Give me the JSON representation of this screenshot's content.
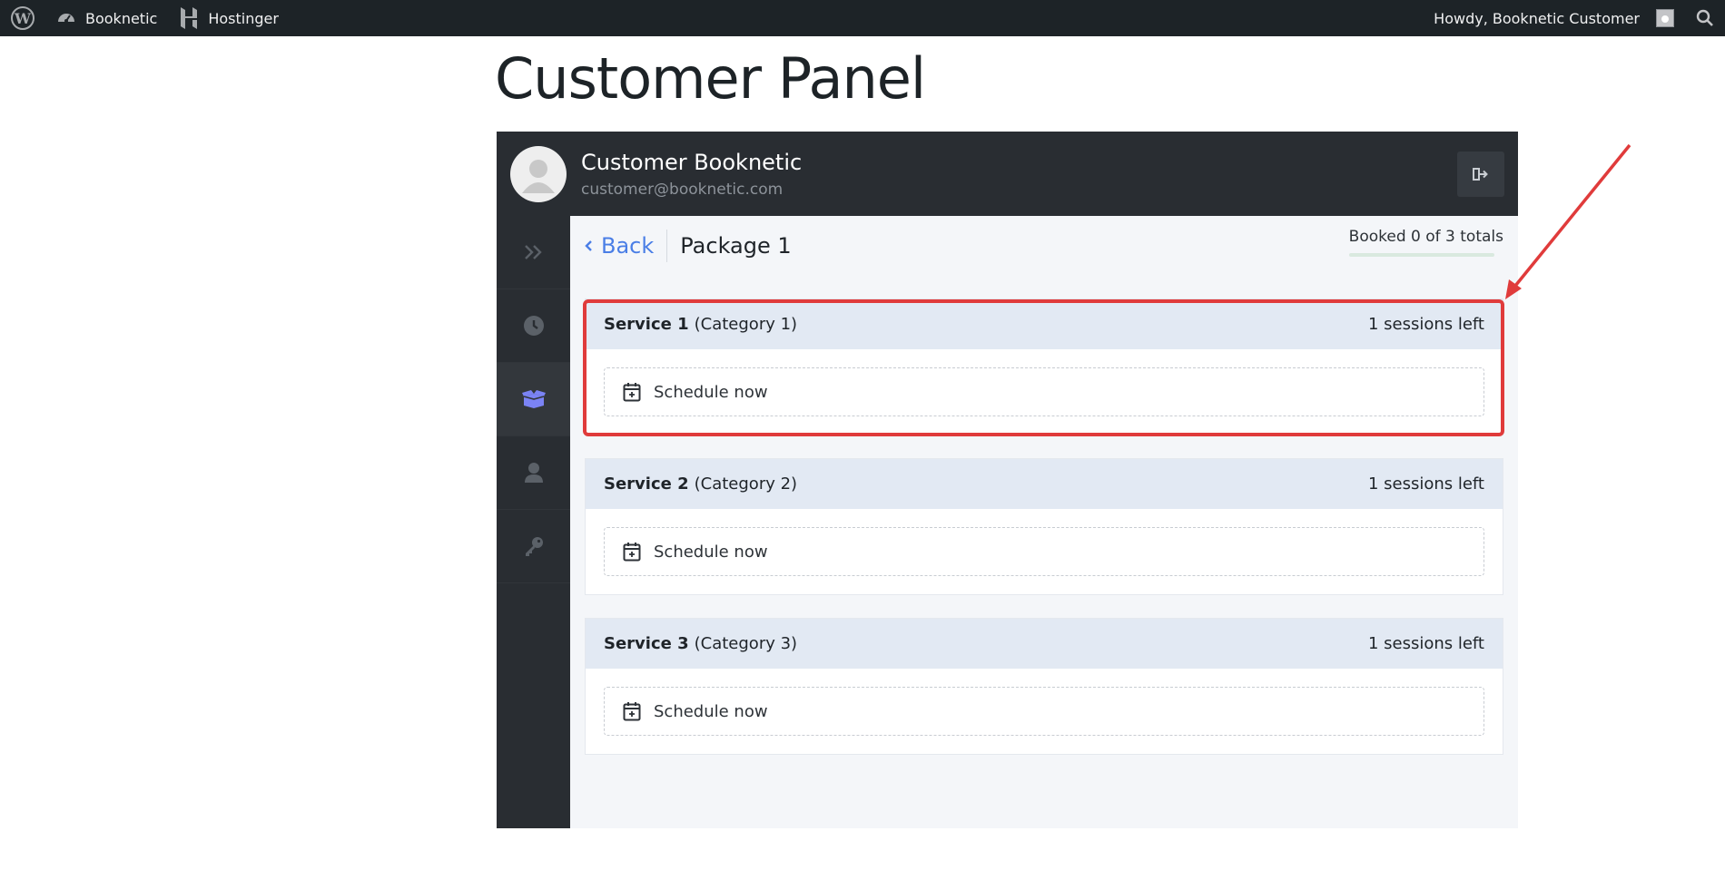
{
  "adminbar": {
    "site_name": "Booknetic",
    "hosting_name": "Hostinger",
    "greeting": "Howdy, Booknetic Customer"
  },
  "page": {
    "title": "Customer Panel"
  },
  "customer": {
    "name": "Customer Booknetic",
    "email": "customer@booknetic.com"
  },
  "package": {
    "back_label": "Back",
    "title": "Package 1",
    "booked_text": "Booked 0 of 3 totals",
    "booked_fraction": 0
  },
  "services": [
    {
      "name": "Service 1",
      "category": "(Category 1)",
      "sessions_left": "1 sessions left",
      "schedule_label": "Schedule now"
    },
    {
      "name": "Service 2",
      "category": "(Category 2)",
      "sessions_left": "1 sessions left",
      "schedule_label": "Schedule now"
    },
    {
      "name": "Service 3",
      "category": "(Category 3)",
      "sessions_left": "1 sessions left",
      "schedule_label": "Schedule now"
    }
  ],
  "sidebar": {
    "items": [
      {
        "icon": "double-chevron-right-icon"
      },
      {
        "icon": "clock-icon"
      },
      {
        "icon": "package-box-icon",
        "active": true
      },
      {
        "icon": "user-icon"
      },
      {
        "icon": "key-icon"
      }
    ]
  },
  "colors": {
    "accent": "#4a7ee6",
    "highlight": "#e03b3b",
    "panel_dark": "#292d32",
    "active_icon": "#7b83f5"
  }
}
